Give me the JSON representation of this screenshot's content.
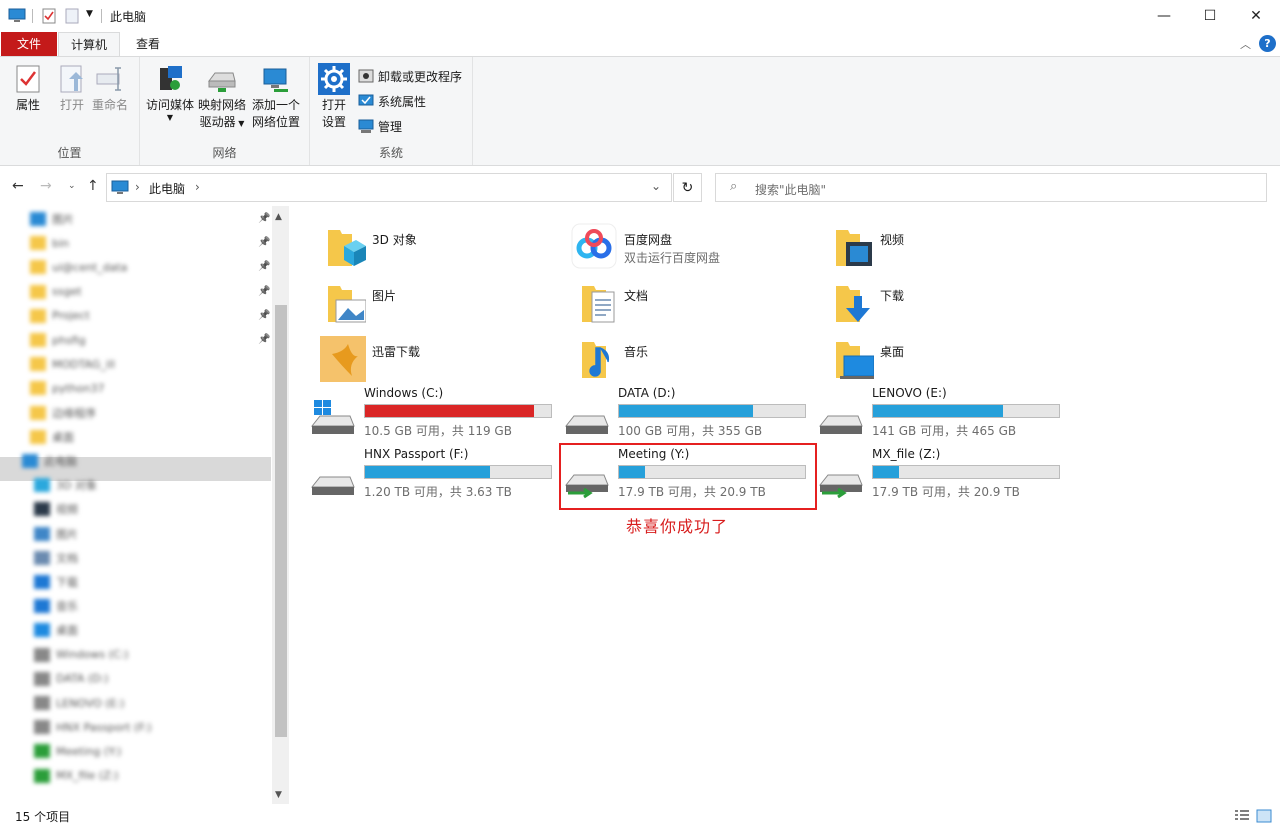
{
  "window": {
    "title": "此电脑",
    "minimize": "—",
    "maximize": "☐",
    "close": "✕"
  },
  "ribbon_tabs": [
    "文件",
    "计算机",
    "查看"
  ],
  "ribbon": {
    "location": {
      "label": "位置",
      "properties": "属性",
      "open": "打开",
      "rename": "重命名"
    },
    "network": {
      "label": "网络",
      "media_line1": "访问媒体",
      "map_line1": "映射网络",
      "map_line2": "驱动器",
      "add_line1": "添加一个",
      "add_line2": "网络位置"
    },
    "system": {
      "label": "系统",
      "settings_line1": "打开",
      "settings_line2": "设置",
      "uninstall": "卸载或更改程序",
      "sysprops": "系统属性",
      "manage": "管理"
    }
  },
  "address": {
    "crumb": "此电脑",
    "search_placeholder": "搜索\"此电脑\""
  },
  "nav_pane": {
    "items": [
      "图片",
      "bin",
      "ui@cent_data",
      "ssget",
      "Project",
      "phsfig",
      "MODTAG_ill",
      "python37",
      "边缘程序",
      "桌面",
      "此电脑",
      "3D 对象",
      "视频",
      "图片",
      "文档",
      "下载",
      "音乐",
      "桌面",
      "Windows (C:)",
      "DATA (D:)",
      "LENOVO (E:)",
      "HNX Passport (F:)",
      "Meeting (Y:)",
      "MX_file (Z:)"
    ]
  },
  "folders": [
    {
      "name": "3D 对象",
      "sub": ""
    },
    {
      "name": "百度网盘",
      "sub": "双击运行百度网盘"
    },
    {
      "name": "视频",
      "sub": ""
    },
    {
      "name": "图片",
      "sub": ""
    },
    {
      "name": "文档",
      "sub": ""
    },
    {
      "name": "下载",
      "sub": ""
    },
    {
      "name": "迅雷下载",
      "sub": ""
    },
    {
      "name": "音乐",
      "sub": ""
    },
    {
      "name": "桌面",
      "sub": ""
    }
  ],
  "drives": [
    {
      "name": "Windows (C:)",
      "free": "10.5 GB 可用，共 119 GB",
      "used_fraction": 0.91
    },
    {
      "name": "DATA (D:)",
      "free": "100 GB 可用，共 355 GB",
      "used_fraction": 0.72
    },
    {
      "name": "LENOVO (E:)",
      "free": "141 GB 可用，共 465 GB",
      "used_fraction": 0.7
    },
    {
      "name": "HNX Passport (F:)",
      "free": "1.20 TB 可用，共 3.63 TB",
      "used_fraction": 0.67
    },
    {
      "name": "Meeting (Y:)",
      "free": "17.9 TB 可用，共 20.9 TB",
      "used_fraction": 0.14
    },
    {
      "name": "MX_file (Z:)",
      "free": "17.9 TB 可用，共 20.9 TB",
      "used_fraction": 0.14
    }
  ],
  "annotation": "恭喜你成功了",
  "status": {
    "count": "15 个项目"
  },
  "colors": {
    "accent": "#26a0da",
    "danger": "#da2626",
    "file_tab": "#c41a1a",
    "annotation": "#d81e1e"
  }
}
